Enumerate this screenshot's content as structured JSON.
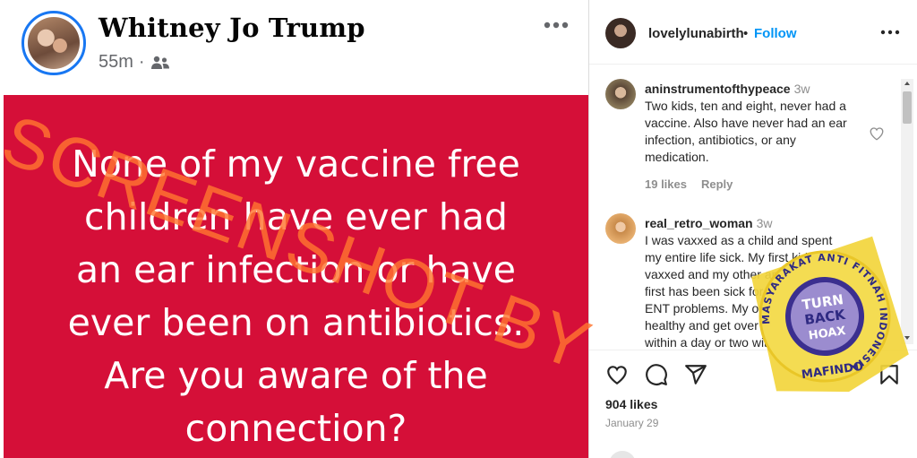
{
  "facebook_post": {
    "author": "Whitney Jo Trump",
    "time": "55m",
    "separator": "·",
    "audience_icon": "friends-icon",
    "more_icon": "more-horizontal-icon",
    "background_color": "#d50f38",
    "text_lines": [
      "None of my vaccine free",
      "children have ever had",
      "an ear infection or have",
      "ever been on antibiotics.",
      "Are you aware of the",
      "connection?"
    ]
  },
  "instagram": {
    "header": {
      "username": "lovelylunabirth",
      "dot": "•",
      "follow_label": "Follow",
      "more_icon": "more-horizontal-icon"
    },
    "comments": [
      {
        "username": "aninstrumentofthypeace",
        "time": "3w",
        "text_lines": [
          "Two kids, ten and eight, never had a",
          "vaccine. Also have never had an ear",
          "infection, antibiotics, or any",
          "medication."
        ],
        "likes": "19 likes",
        "reply_label": "Reply"
      },
      {
        "username": "real_retro_woman",
        "time": "3w",
        "text_lines": [
          "I was vaxxed as a child and spent",
          "my entire life sick. My first kid is",
          "vaxxed and my other are not. My",
          "first has been sick for years with",
          "ENT problems. My others are",
          "healthy and get over anything",
          "within a day or two with no"
        ]
      }
    ],
    "actions": {
      "like_icon": "heart-icon",
      "comment_icon": "comment-icon",
      "share_icon": "send-icon",
      "save_icon": "bookmark-icon"
    },
    "likes_count": "904 likes",
    "post_date": "January 29",
    "accent_color": "#0095f6"
  },
  "overlays": {
    "watermark_text": "SCREENSHOT BY",
    "stamp_ring_text": "MASYARAKAT ANTI FITNAH INDONESIA",
    "stamp_center_lines": [
      "TURN",
      "BACK",
      "HOAX"
    ],
    "stamp_bottom_text": "MAFINDO",
    "stamp_color": "#f2d53c"
  }
}
